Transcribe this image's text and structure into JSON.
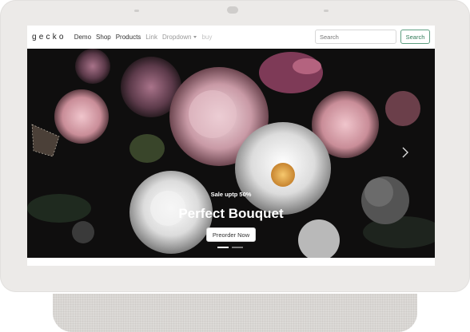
{
  "navbar": {
    "brand": "gecko",
    "links": [
      {
        "label": "Demo"
      },
      {
        "label": "Shop"
      },
      {
        "label": "Products"
      },
      {
        "label": "Link"
      },
      {
        "label": "Dropdown"
      },
      {
        "label": "buy"
      }
    ],
    "search": {
      "placeholder": "Search",
      "button_label": "Search"
    }
  },
  "carousel": {
    "subtitle": "Sale uptp 50%",
    "title": "Perfect Bouquet",
    "cta_label": "Preorder Now",
    "slides": 2,
    "active_slide": 1
  },
  "colors": {
    "device_frame": "#eceae8",
    "search_accent": "#5f9f82",
    "hero_background": "#0f0e0e"
  },
  "icons": {
    "next": "chevron-right-icon",
    "dropdown": "caret-down-icon"
  }
}
